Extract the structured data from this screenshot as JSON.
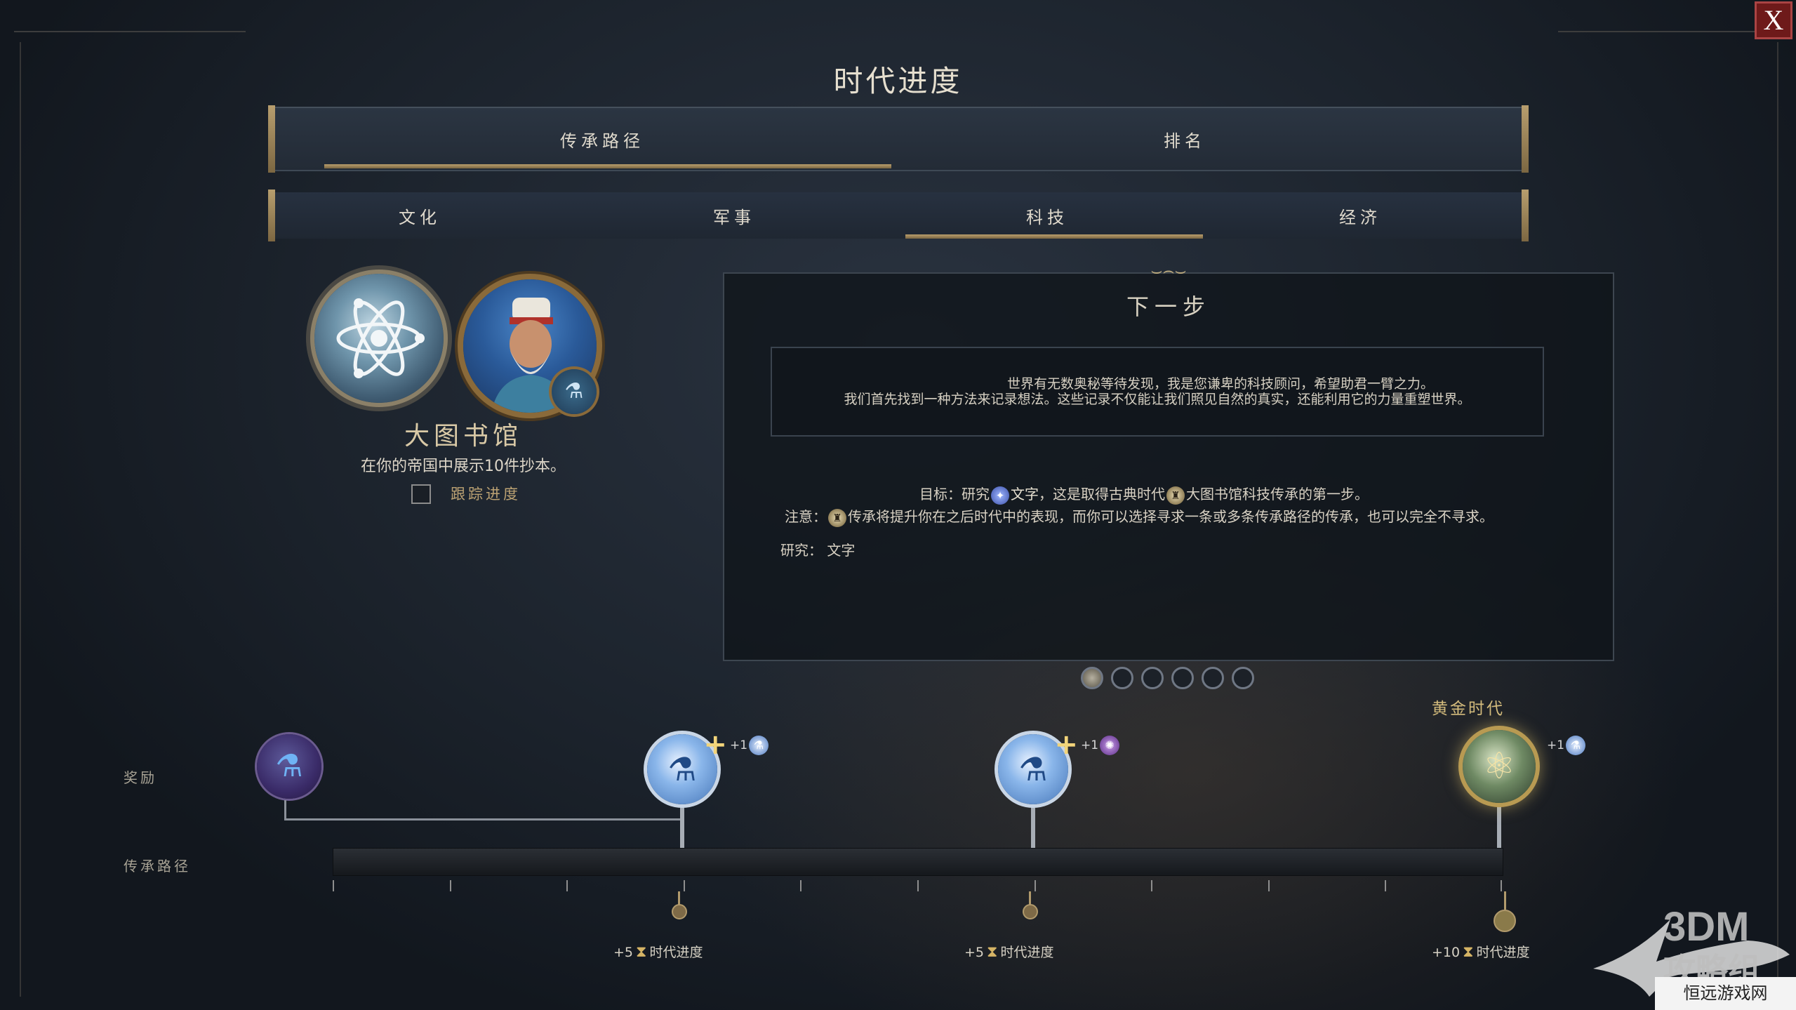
{
  "window": {
    "title": "时代进度",
    "close_label": "X"
  },
  "main_tabs": [
    {
      "label": "传承路径",
      "active": true
    },
    {
      "label": "排名",
      "active": false
    }
  ],
  "sub_tabs": [
    {
      "label": "文化",
      "active": false
    },
    {
      "label": "军事",
      "active": false
    },
    {
      "label": "科技",
      "active": true
    },
    {
      "label": "经济",
      "active": false
    }
  ],
  "legacy": {
    "emblem_icon": "science-atom-emblem-icon",
    "advisor_icon": "advisor-portrait",
    "badge_icon": "flask-icon",
    "name": "大图书馆",
    "description": "在你的帝国中展示10件抄本。",
    "track_label": "跟踪进度",
    "track_checked": false
  },
  "next_step": {
    "title": "下一步",
    "quote_line1": "世界有无数奥秘等待发现，我是您谦卑的科技顾问，希望助君一臂之力。",
    "quote_line2": "我们首先找到一种方法来记录想法。这些记录不仅能让我们照见自然的真实，还能利用它的力量重塑世界。",
    "goal_prefix": "目标：研究",
    "goal_tech": "文字",
    "goal_mid": "，这是取得古典时代",
    "goal_wonder": "大图书馆科技传承的第一步。",
    "note_prefix": "注意：",
    "note_text": "传承将提升你在之后时代中的表现，而你可以选择寻求一条或多条传承路径的传承，也可以完全不寻求。",
    "research_label": "研究：",
    "research_value": "文字",
    "pages": 6,
    "current_page": 1
  },
  "rewards": {
    "label": "奖励",
    "path_label": "传承路径",
    "golden_age_label": "黄金时代",
    "bonuses": [
      {
        "text": "+1",
        "icon": "science-icon"
      },
      {
        "text": "+1",
        "icon": "great-person-icon"
      },
      {
        "text": "+1",
        "icon": "science-icon"
      }
    ],
    "era_progress": [
      {
        "amount": "+5",
        "label": "时代进度"
      },
      {
        "amount": "+5",
        "label": "时代进度"
      },
      {
        "amount": "+10",
        "label": "时代进度"
      }
    ],
    "progress": 0
  },
  "watermark": {
    "brand": "3DM",
    "sub": "攻略组",
    "site": "恒远游戏网"
  },
  "colors": {
    "accent_gold": "#b99e6c",
    "science_blue": "#4575b7"
  }
}
